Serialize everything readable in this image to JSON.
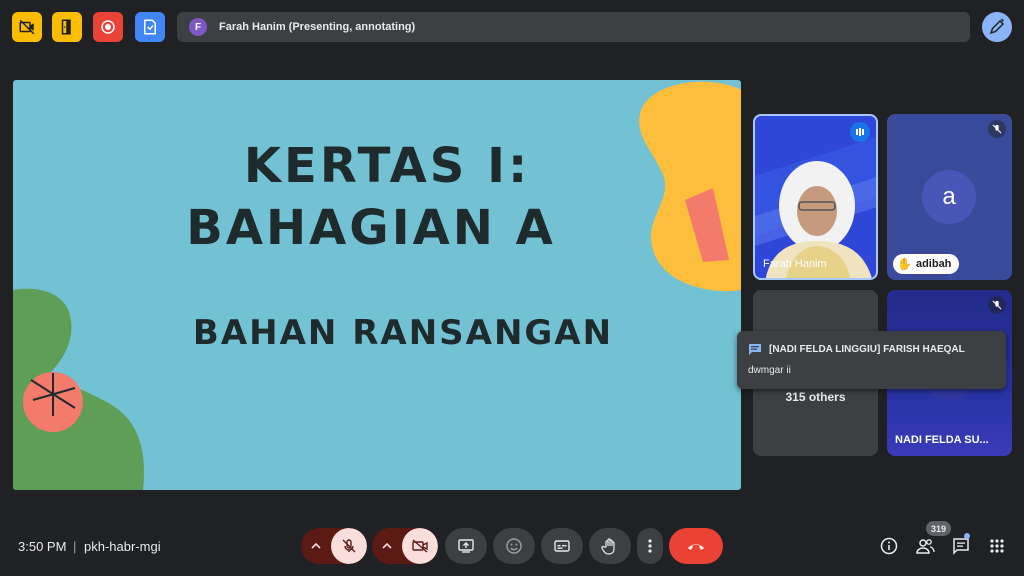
{
  "topbar": {
    "presenter_initial": "F",
    "presenter_status": "Farah Hanim (Presenting, annotating)",
    "icons": [
      "video-off-icon",
      "door-icon",
      "record-icon",
      "save-file-icon",
      "annotate-pen-icon"
    ],
    "colors": {
      "yellow": "#fbbc04",
      "red": "#ea4335",
      "blue": "#4285f4",
      "bar": "#3c4043"
    }
  },
  "slide": {
    "title_line1": "KERTAS I:",
    "title_line2": "BAHAGIAN A",
    "subtitle": "BAHAN RANSANGAN",
    "colors": {
      "background": "#72c2d3",
      "yellow": "#fdbe3c",
      "coral": "#f47b6b",
      "green": "#5e9e57",
      "text": "#1f2a2c"
    }
  },
  "participants": {
    "farah": {
      "name": "Farah Hanim"
    },
    "adibah": {
      "initial": "a",
      "name": "adibah"
    },
    "others": {
      "label": "315 others"
    },
    "nadi": {
      "name": "NADI FELDA SU..."
    }
  },
  "toast": {
    "title": "[NADI FELDA LINGGIU] FARISH HAEQAL",
    "message": "dwmgar ii"
  },
  "bottombar": {
    "time": "3:50 PM",
    "separator": "|",
    "meeting_code": "pkh-habr-mgi",
    "participant_count": "319",
    "colors": {
      "end_call": "#ea4335",
      "muted_bg": "#f9dedc",
      "muted_pair": "#5c1a14"
    }
  }
}
